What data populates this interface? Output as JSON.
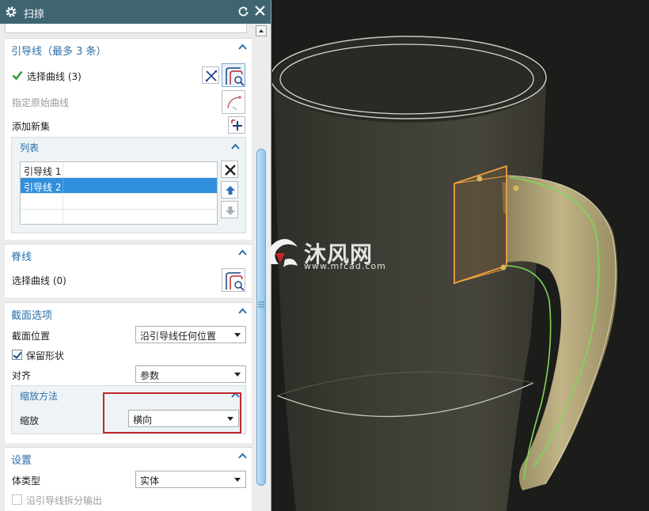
{
  "dialog": {
    "title": "扫掠",
    "guide_section": {
      "title": "引导线（最多 3 条）",
      "select_curve": "选择曲线 (3)",
      "specify_original": "指定原始曲线",
      "add_new_set": "添加新集",
      "list": {
        "title": "列表",
        "rows": [
          "引导线 1",
          "引导线 2"
        ]
      }
    },
    "spine_section": {
      "title": "脊线",
      "select_curve": "选择曲线 (0)"
    },
    "section_options": {
      "title": "截面选项",
      "position_label": "截面位置",
      "position_value": "沿引导线任何位置",
      "keep_shape": "保留形状",
      "align_label": "对齐",
      "align_value": "参数",
      "scaling": {
        "title": "缩放方法",
        "scale_label": "缩放",
        "scale_value": "横向"
      }
    },
    "settings": {
      "title": "设置",
      "body_type_label": "体类型",
      "body_type_value": "实体",
      "split_output": "沿引导线拆分输出"
    }
  },
  "watermark": {
    "name": "沐风网",
    "url": "www.mfcad.com"
  },
  "colors": {
    "titlebar": "#3f6573",
    "section_header": "#2b6fa8",
    "selection": "#2f8fdc",
    "highlight_box": "#c0262b",
    "cup_body": "#403f37",
    "handle": "#b5a77a",
    "guide_curve": "#7ed957",
    "section_outline": "#f0a040"
  }
}
